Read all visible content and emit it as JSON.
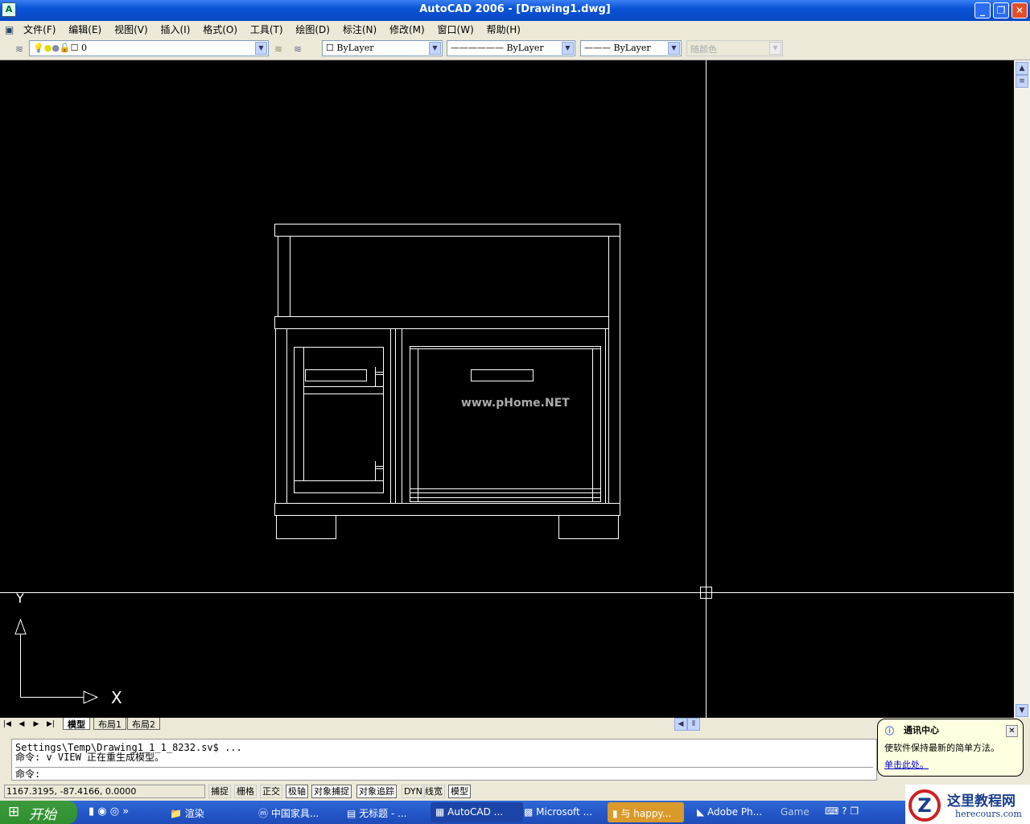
{
  "window": {
    "title": "AutoCAD 2006 - [Drawing1.dwg]",
    "app_icon": "A"
  },
  "menu": [
    "文件(F)",
    "编辑(E)",
    "视图(V)",
    "插入(I)",
    "格式(O)",
    "工具(T)",
    "绘图(D)",
    "标注(N)",
    "修改(M)",
    "窗口(W)",
    "帮助(H)"
  ],
  "toolbar": {
    "layer": "0",
    "color": "ByLayer",
    "linetype": "ByLayer",
    "lineweight": "ByLayer",
    "plotstyle": "随颜色"
  },
  "drawing": {
    "watermark": "www.pHome.NET",
    "ucs_x": "X",
    "ucs_y": "Y"
  },
  "layout_tabs": [
    "模型",
    "布局1",
    "布局2"
  ],
  "command": {
    "lines": [
      "Settings\\Temp\\Drawing1_1_1_8232.sv$ ...",
      "命令: v VIEW 正在重生成模型。"
    ],
    "prompt": "命令:"
  },
  "status": {
    "coords": "1167.3195, -87.4166, 0.0000",
    "toggles": [
      {
        "label": "捕捉",
        "on": false
      },
      {
        "label": "栅格",
        "on": false
      },
      {
        "label": "正交",
        "on": false
      },
      {
        "label": "极轴",
        "on": true
      },
      {
        "label": "对象捕捉",
        "on": true
      },
      {
        "label": "对象追踪",
        "on": true
      },
      {
        "label": "DYN",
        "on": false
      },
      {
        "label": "线宽",
        "on": false
      },
      {
        "label": "模型",
        "on": true
      }
    ]
  },
  "balloon": {
    "title": "通讯中心",
    "text": "使软件保持最新的简单方法。",
    "link": "单击此处。"
  },
  "taskbar": {
    "start": "开始",
    "tasks": [
      "渲染",
      "中国家具...",
      "无标题 - ...",
      "AutoCAD ...",
      "Microsoft ...",
      "与 happy...",
      "Adobe Ph..."
    ],
    "game": "Game"
  },
  "logo": {
    "name": "这里教程网",
    "url": "herecours.com"
  }
}
